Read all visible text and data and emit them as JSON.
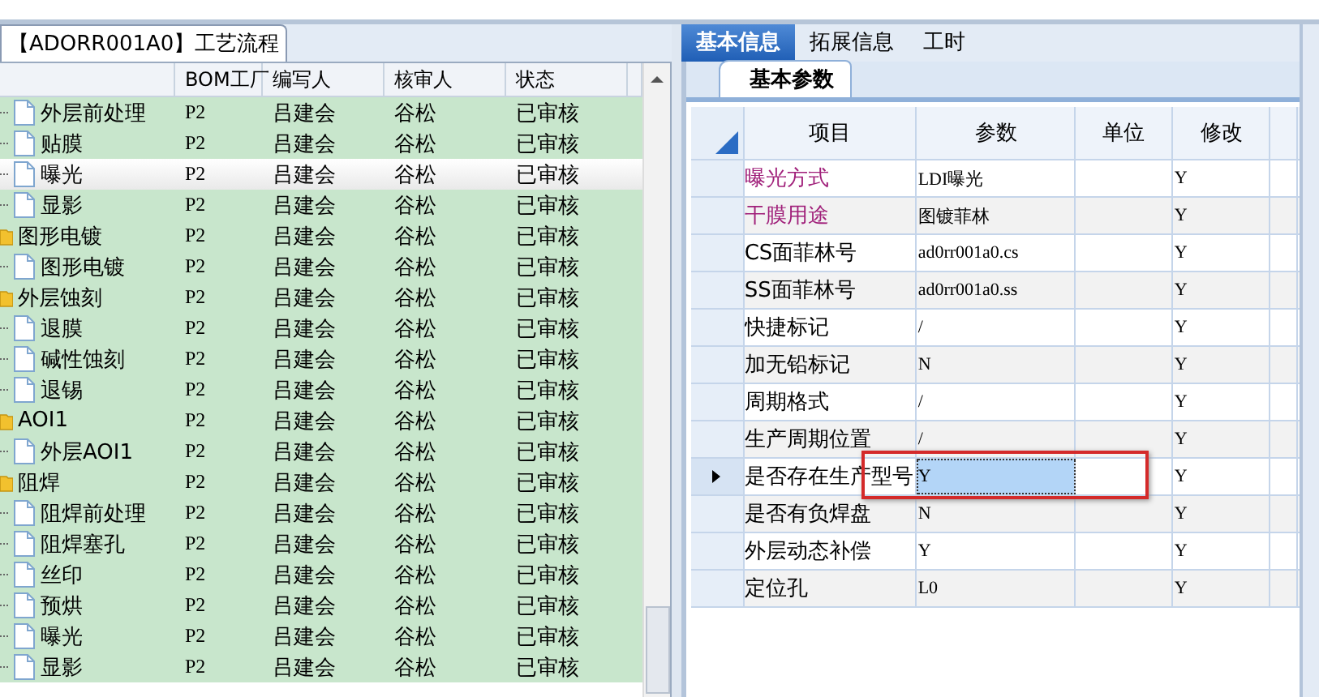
{
  "left_panel": {
    "tab_title": "【ADORR001A0】工艺流程",
    "columns": [
      "BOM工厂",
      "编写人",
      "核审人",
      "状态"
    ],
    "tree": [
      {
        "kind": "file",
        "name": "外层前处理",
        "selected": false,
        "cells": [
          "P2",
          "吕建会",
          "谷松",
          "已审核"
        ]
      },
      {
        "kind": "file",
        "name": "贴膜",
        "selected": false,
        "cells": [
          "P2",
          "吕建会",
          "谷松",
          "已审核"
        ]
      },
      {
        "kind": "file",
        "name": "曝光",
        "selected": true,
        "cells": [
          "P2",
          "吕建会",
          "谷松",
          "已审核"
        ]
      },
      {
        "kind": "file",
        "name": "显影",
        "selected": false,
        "cells": [
          "P2",
          "吕建会",
          "谷松",
          "已审核"
        ]
      },
      {
        "kind": "folder",
        "name": "图形电镀",
        "selected": false,
        "cells": [
          "P2",
          "吕建会",
          "谷松",
          "已审核"
        ],
        "children": [
          {
            "kind": "file",
            "name": "图形电镀",
            "selected": false,
            "cells": [
              "P2",
              "吕建会",
              "谷松",
              "已审核"
            ]
          }
        ]
      },
      {
        "kind": "folder",
        "name": "外层蚀刻",
        "selected": false,
        "cells": [
          "P2",
          "吕建会",
          "谷松",
          "已审核"
        ],
        "children": [
          {
            "kind": "file",
            "name": "退膜",
            "selected": false,
            "cells": [
              "P2",
              "吕建会",
              "谷松",
              "已审核"
            ]
          },
          {
            "kind": "file",
            "name": "碱性蚀刻",
            "selected": false,
            "cells": [
              "P2",
              "吕建会",
              "谷松",
              "已审核"
            ]
          },
          {
            "kind": "file",
            "name": "退锡",
            "selected": false,
            "cells": [
              "P2",
              "吕建会",
              "谷松",
              "已审核"
            ]
          }
        ]
      },
      {
        "kind": "folder",
        "name": "AOI1",
        "selected": false,
        "cells": [
          "P2",
          "吕建会",
          "谷松",
          "已审核"
        ],
        "children": [
          {
            "kind": "file",
            "name": "外层AOI1",
            "selected": false,
            "cells": [
              "P2",
              "吕建会",
              "谷松",
              "已审核"
            ]
          }
        ]
      },
      {
        "kind": "folder",
        "name": "阻焊",
        "selected": false,
        "cells": [
          "P2",
          "吕建会",
          "谷松",
          "已审核"
        ],
        "children": [
          {
            "kind": "file",
            "name": "阻焊前处理",
            "selected": false,
            "cells": [
              "P2",
              "吕建会",
              "谷松",
              "已审核"
            ]
          },
          {
            "kind": "file",
            "name": "阻焊塞孔",
            "selected": false,
            "cells": [
              "P2",
              "吕建会",
              "谷松",
              "已审核"
            ]
          },
          {
            "kind": "file",
            "name": "丝印",
            "selected": false,
            "cells": [
              "P2",
              "吕建会",
              "谷松",
              "已审核"
            ]
          },
          {
            "kind": "file",
            "name": "预烘",
            "selected": false,
            "cells": [
              "P2",
              "吕建会",
              "谷松",
              "已审核"
            ]
          },
          {
            "kind": "file",
            "name": "曝光",
            "selected": false,
            "cells": [
              "P2",
              "吕建会",
              "谷松",
              "已审核"
            ]
          },
          {
            "kind": "file",
            "name": "显影",
            "selected": false,
            "cells": [
              "P2",
              "吕建会",
              "谷松",
              "已审核"
            ]
          }
        ]
      }
    ]
  },
  "right_panel": {
    "tabs": [
      {
        "label": "基本信息",
        "selected": true
      },
      {
        "label": "拓展信息",
        "selected": false
      },
      {
        "label": "工时",
        "selected": false
      }
    ],
    "subtab": "基本参数",
    "columns": [
      "项目",
      "参数",
      "单位",
      "修改"
    ],
    "rows": [
      {
        "item": "曝光方式",
        "color": "#a0207a",
        "param": "LDI曝光",
        "modify": "Y",
        "selected": false
      },
      {
        "item": "干膜用途",
        "color": "#a0207a",
        "param": "图镀菲林",
        "modify": "Y",
        "selected": false
      },
      {
        "item": "CS面菲林号",
        "color": "#000000",
        "param": "ad0rr001a0.cs",
        "modify": "Y",
        "selected": false
      },
      {
        "item": "SS面菲林号",
        "color": "#000000",
        "param": "ad0rr001a0.ss",
        "modify": "Y",
        "selected": false
      },
      {
        "item": "快捷标记",
        "color": "#000000",
        "param": "/",
        "modify": "Y",
        "selected": false
      },
      {
        "item": "加无铅标记",
        "color": "#000000",
        "param": "N",
        "modify": "Y",
        "selected": false
      },
      {
        "item": "周期格式",
        "color": "#000000",
        "param": "/",
        "modify": "Y",
        "selected": false
      },
      {
        "item": "生产周期位置",
        "color": "#000000",
        "param": "/",
        "modify": "Y",
        "selected": false
      },
      {
        "item": "是否存在生产型号",
        "color": "#000000",
        "param": "Y",
        "modify": "Y",
        "selected": true
      },
      {
        "item": "是否有负焊盘",
        "color": "#000000",
        "param": "N",
        "modify": "Y",
        "selected": false
      },
      {
        "item": "外层动态补偿",
        "color": "#000000",
        "param": "Y",
        "modify": "Y",
        "selected": false
      },
      {
        "item": "定位孔",
        "color": "#000000",
        "param": "L0",
        "modify": "Y",
        "selected": false
      }
    ]
  }
}
